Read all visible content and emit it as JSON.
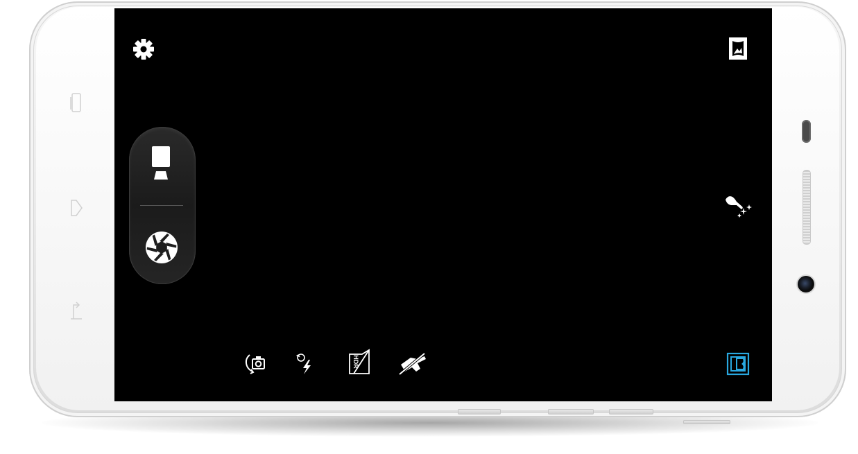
{
  "device": {
    "screen_color": "#000000",
    "bezel_color": "#f0f0f0"
  },
  "camera_ui": {
    "top_left": {
      "icon": "settings-gear-icon"
    },
    "top_right": {
      "icon": "panorama-mode-icon"
    },
    "mode_switcher": {
      "video_icon": "video-camera-icon",
      "shutter_icon": "shutter-aperture-icon"
    },
    "right_side": {
      "icon": "beauty-mode-icon"
    },
    "bottom_toolbar": [
      {
        "icon": "switch-camera-icon"
      },
      {
        "icon": "flash-auto-icon",
        "label": "A"
      },
      {
        "icon": "hdr-icon",
        "label": "HDR"
      },
      {
        "icon": "night-mode-off-icon"
      }
    ],
    "gallery_thumbnail": {
      "icon": "gallery-thumbnail-icon",
      "color": "#29a8e0"
    }
  }
}
